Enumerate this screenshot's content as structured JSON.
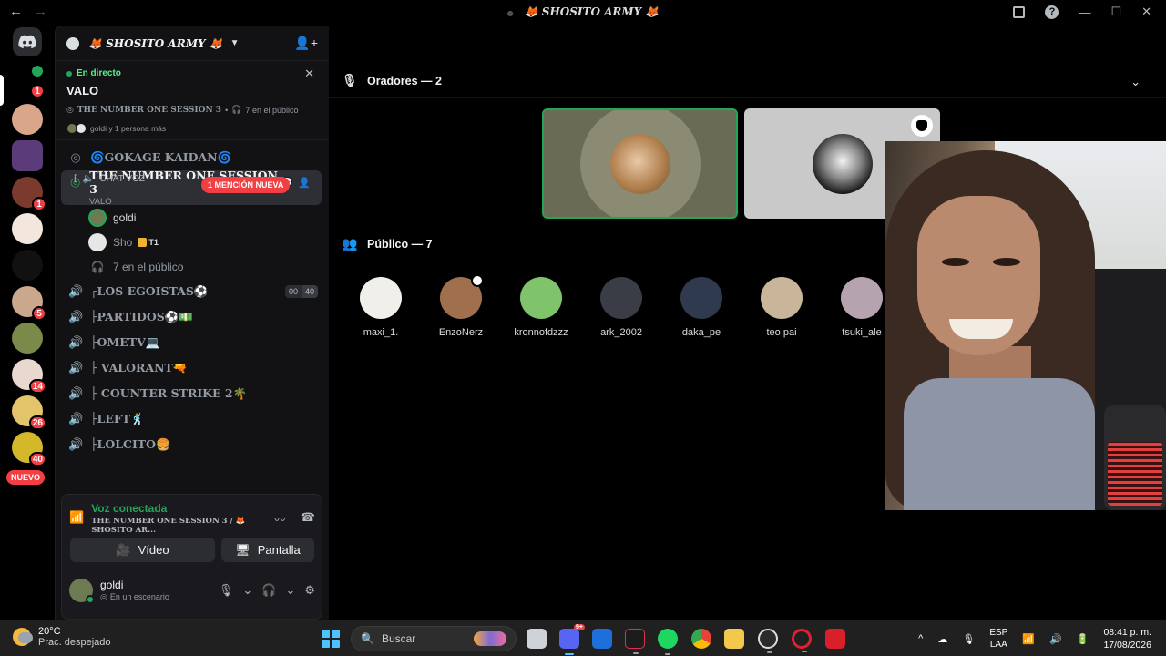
{
  "window": {
    "title": "🦊 SHOSITO ARMY 🦊",
    "back": "←",
    "forward": "→"
  },
  "server": {
    "name": "🦊 SHOSITO ARMY 🦊"
  },
  "rail": {
    "badges": [
      "1",
      "1",
      "5",
      "14",
      "26",
      "40"
    ],
    "new_label": "NUEVO"
  },
  "live": {
    "tag": "En directo",
    "title": "VALO",
    "channel": "THE NUMBER ONE SESSION 3",
    "audience": "7 en el público",
    "people": "goldi y 1 persona más"
  },
  "channels": {
    "chat_voz": "CHAT VOZ",
    "mention_pill": "1 MENCIÓN NUEVA",
    "items": [
      {
        "label": "🌀GOKAGE KAIDAN🌀",
        "icon": "stage"
      },
      {
        "label": "THE NUMBER ONE SESSION 3",
        "icon": "stage",
        "sub": "VALO"
      },
      {
        "label": "┌LOS EGOISTAS⚽",
        "icon": "voice",
        "count_a": "00",
        "count_b": "40"
      },
      {
        "label": "├PARTIDOS⚽💵",
        "icon": "voice"
      },
      {
        "label": "├OMETV💻",
        "icon": "voice"
      },
      {
        "label": "├ VALORANT🔫",
        "icon": "voice"
      },
      {
        "label": "├ COUNTER STRIKE 2🌴",
        "icon": "voice"
      },
      {
        "label": "├LEFT🕺",
        "icon": "voice"
      },
      {
        "label": "├LOLCITO🍔",
        "icon": "voice"
      }
    ],
    "members": [
      {
        "name": "goldi"
      },
      {
        "name": "Sho",
        "tag": "T1"
      }
    ],
    "audience_row": "7 en el público"
  },
  "voice": {
    "status": "Voz conectada",
    "channel": "THE NUMBER ONE SESSION 3 / 🦊 SHOSITO AR...",
    "video_label": "Vídeo",
    "screen_label": "Pantalla"
  },
  "user": {
    "name": "goldi",
    "status": "En un escenario"
  },
  "stage": {
    "speakers_header": "Oradores — 2",
    "audience_header": "Público — 7",
    "audience": [
      {
        "name": "maxi_1.",
        "color": "#f0efe9"
      },
      {
        "name": "EnzoNerz",
        "color": "#a0704e"
      },
      {
        "name": "kronnofdzzz",
        "color": "#7fc36a"
      },
      {
        "name": "ark_2002",
        "color": "#3a3c46"
      },
      {
        "name": "daka_pe",
        "color": "#2f3a4e"
      },
      {
        "name": "teo pai",
        "color": "#c9b59a"
      },
      {
        "name": "tsuki_ale",
        "color": "#b6a3b0"
      }
    ]
  },
  "taskbar": {
    "temp": "20°C",
    "weather": "Prac. despejado",
    "search": "Buscar",
    "discord_badge": "9+",
    "lang_a": "ESP",
    "lang_b": "LAA",
    "time": "08:41 p. m.",
    "date": "17/08/2026"
  }
}
